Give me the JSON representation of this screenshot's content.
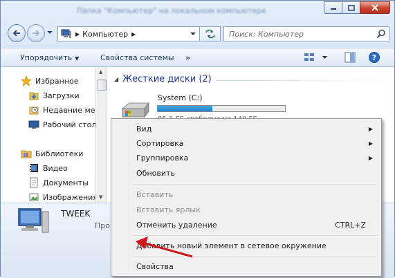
{
  "window": {
    "title": "Папка \"Компьютер\" на локальном компьютере",
    "minimize_icon": "minimize-icon",
    "maximize_icon": "maximize-icon",
    "close_icon": "close-icon"
  },
  "address": {
    "path": "Компьютер",
    "separator": "▶",
    "search_placeholder": "Поиск: Компьютер"
  },
  "toolbar": {
    "organize": "Упорядочить",
    "system_properties": "Свойства системы",
    "more": "»"
  },
  "nav": {
    "favorites": "Избранное",
    "downloads": "Загрузки",
    "recent": "Недавние мес",
    "desktop": "Рабочий стол",
    "libraries": "Библиотеки",
    "video": "Видео",
    "documents": "Документы",
    "images": "Изображения"
  },
  "content": {
    "group_title": "Жесткие диски (2)",
    "drive_name": "System (C:)",
    "drive_usage": 0.43,
    "drive_free": "85,1 ГБ свободно из 140 ГБ"
  },
  "details": {
    "name": "TWEEK",
    "sub": "Проц"
  },
  "menu": {
    "view": "Вид",
    "sort": "Сортировка",
    "group": "Группировка",
    "refresh": "Обновить",
    "paste": "Вставить",
    "paste_shortcut": "Вставить ярлык",
    "undo_delete": "Отменить удаление",
    "undo_shortcut": "CTRL+Z",
    "add_network": "Добавить новый элемент в сетевое окружение",
    "properties": "Свойства"
  },
  "colors": {
    "accent": "#1e3287",
    "annotation_arrow": "#d0161a",
    "drive_bar": "#2b8fd3"
  }
}
